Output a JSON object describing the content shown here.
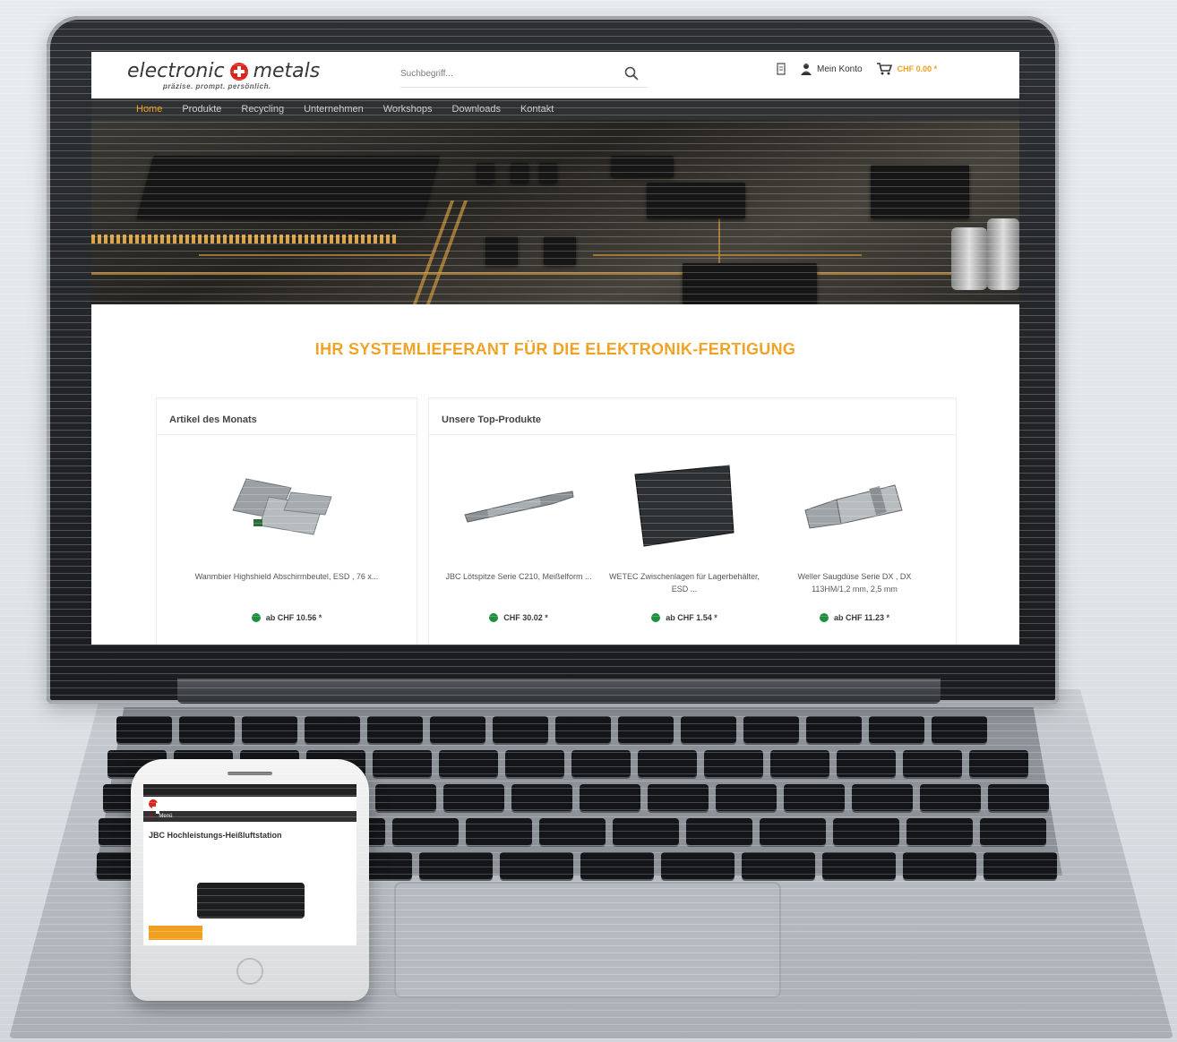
{
  "site": {
    "logo_text_1": "electronic",
    "logo_text_2": "metals",
    "tagline": "präzise. prompt. persönlich.",
    "search_placeholder": "Suchbegriff...",
    "account_label": "Mein Konto",
    "cart_price": "CHF 0.00 *"
  },
  "nav": {
    "items": [
      "Home",
      "Produkte",
      "Recycling",
      "Unternehmen",
      "Workshops",
      "Downloads",
      "Kontakt"
    ],
    "active_index": 0
  },
  "headline": "IHR SYSTEMLIEFERANT FÜR DIE ELEKTRONIK-FERTIGUNG",
  "month_box": {
    "title": "Artikel des Monats",
    "product": {
      "name": "Wanmbier Highshield Abschirmbeutel, ESD , 76 x...",
      "price": "ab CHF 10.56 *",
      "icon": "shielding-bags-image"
    }
  },
  "top_box": {
    "title": "Unsere Top-Produkte",
    "products": [
      {
        "name": "JBC Lötspitze Serie C210, Meißelform ...",
        "price": "CHF 30.02 *",
        "icon": "soldering-tip-image"
      },
      {
        "name": "WETEC Zwischenlagen für Lagerbehälter, ESD ...",
        "price": "ab CHF 1.54 *",
        "icon": "esd-sheet-image"
      },
      {
        "name": "Weller Saugdüse Serie DX , DX 113HM/1,2 mm, 2,5 mm",
        "price": "ab CHF 11.23 *",
        "icon": "suction-nozzle-image"
      }
    ]
  },
  "colors": {
    "accent": "#f0a020",
    "nav_bg": "#303133",
    "in_stock": "#1e8f3c",
    "brand_red": "#d9261c"
  },
  "phone": {
    "product_title": "JBC Hochleistungs-Heißluftstation",
    "menu_label": "Menü"
  }
}
